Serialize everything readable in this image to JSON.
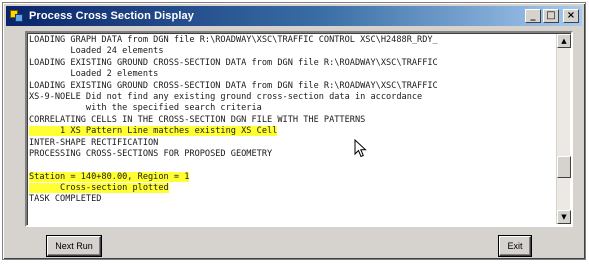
{
  "window": {
    "title": "Process Cross Section Display",
    "minimize_glyph": "_",
    "maximize_glyph": "□",
    "close_glyph": "×"
  },
  "log": {
    "lines": [
      {
        "text": "LOADING GRAPH DATA from DGN file R:\\ROADWAY\\XSC\\TRAFFIC CONTROL XSC\\H2488R_RDY_",
        "highlight": false
      },
      {
        "text": "        Loaded 24 elements",
        "highlight": false
      },
      {
        "text": "LOADING EXISTING GROUND CROSS-SECTION DATA from DGN file R:\\ROADWAY\\XSC\\TRAFFIC",
        "highlight": false
      },
      {
        "text": "        Loaded 2 elements",
        "highlight": false
      },
      {
        "text": "LOADING EXISTING GROUND CROSS-SECTION DATA from DGN file R:\\ROADWAY\\XSC\\TRAFFIC",
        "highlight": false
      },
      {
        "text": "XS-9-NOELE Did not find any existing ground cross-section data in accordance",
        "highlight": false
      },
      {
        "text": "           with the specified search criteria",
        "highlight": false
      },
      {
        "text": "CORRELATING CELLS IN THE CROSS-SECTION DGN FILE WITH THE PATTERNS",
        "highlight": false
      },
      {
        "text": "      1 XS Pattern Line matches existing XS Cell",
        "highlight": true
      },
      {
        "text": "INTER-SHAPE RECTIFICATION",
        "highlight": false
      },
      {
        "text": "PROCESSING CROSS-SECTIONS FOR PROPOSED GEOMETRY",
        "highlight": false
      },
      {
        "text": "",
        "highlight": false
      },
      {
        "text": "Station = 140+80.00, Region = 1",
        "highlight": true
      },
      {
        "text": "      Cross-section plotted",
        "highlight": true
      },
      {
        "text": "TASK COMPLETED",
        "highlight": false
      }
    ]
  },
  "scrollbar": {
    "up_glyph": "▲",
    "down_glyph": "▼"
  },
  "buttons": {
    "next_run": "Next Run",
    "exit": "Exit"
  }
}
